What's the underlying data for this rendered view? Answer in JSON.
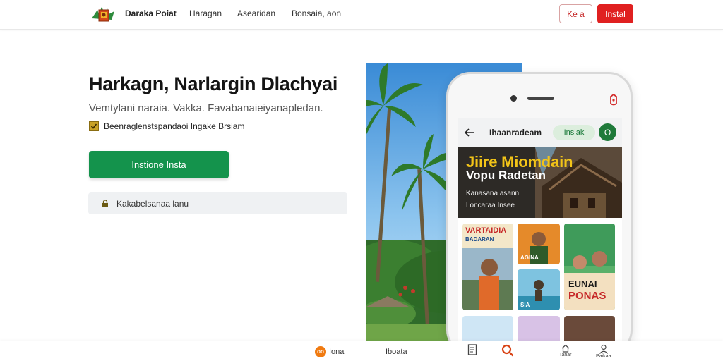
{
  "header": {
    "brand": "Daraka Poiat",
    "nav": [
      "Haragan",
      "Asearidan",
      "Bonsaia, aon"
    ],
    "login_label": "Ke a",
    "install_label": "Instal"
  },
  "hero": {
    "title": "Harkagn, Narlargin Dlachyai",
    "subtitle": "Vemtylani naraia. Vakka. Favabanaieiyanapledan.",
    "check_text": "Beenraglenstspandaoi Ingake Brsiam",
    "cta_label": "Instione Insta",
    "info_text": "Kakabelsanaa lanu"
  },
  "app": {
    "title": "Ihaanradeam",
    "install_label": "Insiak",
    "avatar_letter": "O",
    "banner": {
      "headline": "Jiire Miomdain",
      "subheadline": "Vopu Radetan",
      "line1": "Kanasana asann",
      "line2": "Loncaraa Insee"
    },
    "cards": [
      {
        "label": "VARTAIDIA",
        "sub": "BADARAN"
      },
      {
        "label": "AGINA",
        "sub": ""
      },
      {
        "label": "SIA",
        "sub": ""
      },
      {
        "label": "",
        "sub": ""
      },
      {
        "label": "EUNAI",
        "sub": "PONAS"
      }
    ]
  },
  "bottom_nav": {
    "badge": "oo",
    "item1": "Iona",
    "item2": "Iboata",
    "icon_labels": [
      "",
      "",
      "Tanar",
      "Paikaa"
    ]
  },
  "colors": {
    "primary_red": "#e02020",
    "cta_green": "#14934c",
    "accent_yellow": "#f2c418",
    "badge_orange": "#f07a10"
  }
}
